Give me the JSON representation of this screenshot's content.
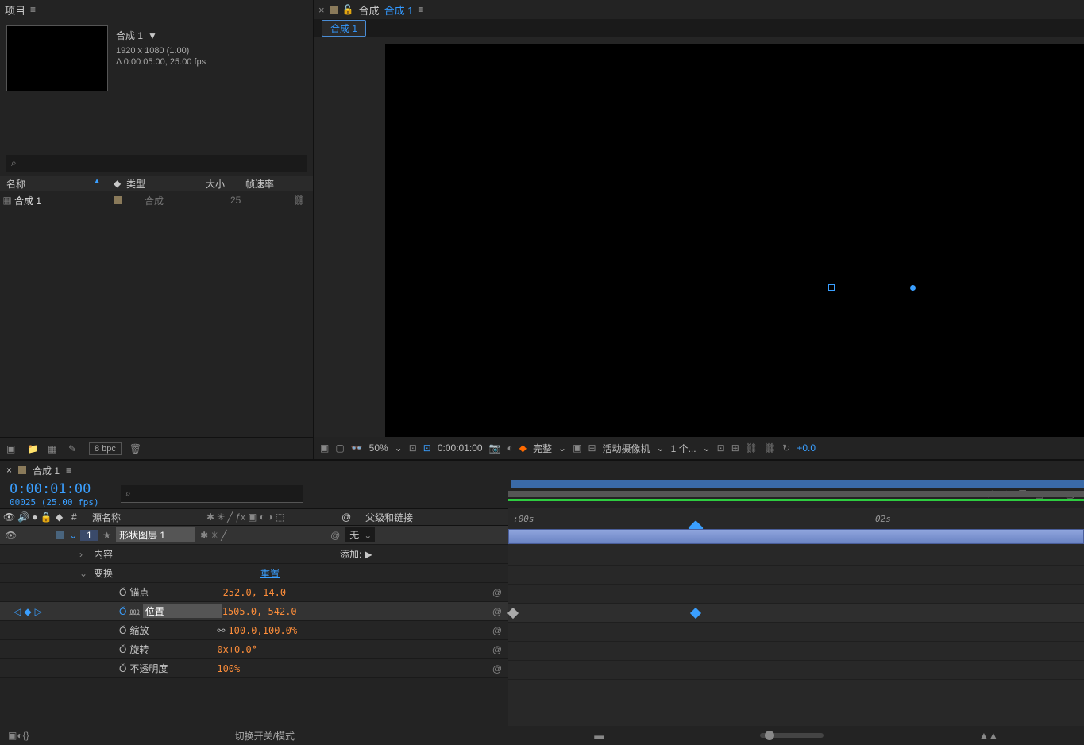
{
  "project": {
    "panel_title": "项目",
    "comp_name": "合成 1",
    "dimensions": "1920 x 1080 (1.00)",
    "duration_fps": "Δ 0:00:05:00, 25.00 fps",
    "search_placeholder": "⌕",
    "columns": {
      "name": "名称",
      "type": "类型",
      "size": "大小",
      "fps": "帧速率"
    },
    "row": {
      "name": "合成 1",
      "type": "合成",
      "fps": "25"
    },
    "bpc": "8 bpc"
  },
  "composition": {
    "header_label": "合成",
    "active_tab": "合成 1",
    "tab": "合成 1",
    "zoom": "50%",
    "time": "0:00:01:00",
    "resolution": "完整",
    "camera": "活动摄像机",
    "views": "1 个...",
    "exposure": "+0.0"
  },
  "timeline": {
    "tab": "合成 1",
    "current_time": "0:00:01:00",
    "frame_info": "00025 (25.00 fps)",
    "cols": {
      "idx": "#",
      "source": "源名称",
      "parent": "父级和链接"
    },
    "layer": {
      "index": "1",
      "name": "形状图层 1",
      "parent": "无"
    },
    "content_label": "内容",
    "add_label": "添加:",
    "transform_label": "变换",
    "reset_label": "重置",
    "anchor": {
      "label": "锚点",
      "val": "-252.0, 14.0"
    },
    "position": {
      "label": "位置",
      "val": "1505.0, 542.0"
    },
    "scale": {
      "label": "缩放",
      "val1": "100.0",
      "val2": "100.0",
      "pct": "%"
    },
    "rotation": {
      "label": "旋转",
      "val": "0x+0.0°"
    },
    "opacity": {
      "label": "不透明度",
      "val": "100%"
    },
    "ruler": {
      "t0": ":00s",
      "t1": "02s"
    },
    "switch_modes": "切换开关/模式",
    "search": "⌕"
  }
}
